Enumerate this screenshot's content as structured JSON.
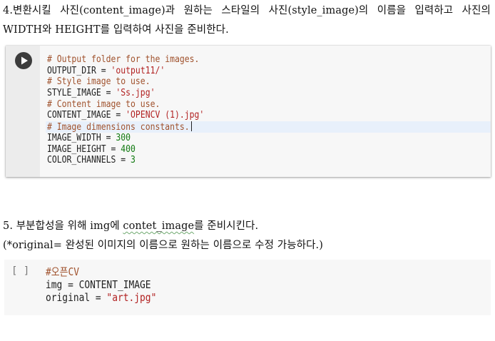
{
  "section4": {
    "text": "4.변환시킬 사진(content_image)과 원하는 스타일의 사진(style_image)의 이름을 입력하고 사진의 WIDTH와 HEIGHT를 입력하여 사진을 준비한다."
  },
  "cell1": {
    "run_button": "run",
    "lines": [
      {
        "parts": [
          {
            "t": "# Output folder for the images.",
            "c": "cm"
          }
        ]
      },
      {
        "parts": [
          {
            "t": "OUTPUT_DIR = ",
            "c": "tx"
          },
          {
            "t": "'output11/'",
            "c": "st"
          }
        ]
      },
      {
        "parts": [
          {
            "t": "# Style image to use.",
            "c": "cm"
          }
        ]
      },
      {
        "parts": [
          {
            "t": "STYLE_IMAGE = ",
            "c": "tx"
          },
          {
            "t": "'Ss.jpg'",
            "c": "st"
          }
        ]
      },
      {
        "parts": [
          {
            "t": "# Content image to use.",
            "c": "cm"
          }
        ]
      },
      {
        "parts": [
          {
            "t": "CONTENT_IMAGE = ",
            "c": "tx"
          },
          {
            "t": "'OPENCV (1).jpg'",
            "c": "st"
          }
        ]
      },
      {
        "parts": [
          {
            "t": "# Image dimensions constants.",
            "c": "cm"
          }
        ],
        "active": true
      },
      {
        "parts": [
          {
            "t": "IMAGE_WIDTH = ",
            "c": "tx"
          },
          {
            "t": "300",
            "c": "nm"
          }
        ]
      },
      {
        "parts": [
          {
            "t": "IMAGE_HEIGHT = ",
            "c": "tx"
          },
          {
            "t": "400",
            "c": "nm"
          }
        ]
      },
      {
        "parts": [
          {
            "t": "COLOR_CHANNELS = ",
            "c": "tx"
          },
          {
            "t": "3",
            "c": "nm"
          }
        ]
      }
    ]
  },
  "section5": {
    "title_pre": "5. 부분합성을 위해 img에 ",
    "title_underlined": "contet_image",
    "title_post": "를 준비시킨다.",
    "note": "(*original= 완성된 이미지의 이름으로 원하는 이름으로 수정 가능하다.)"
  },
  "cell2": {
    "bracket": "[ ]",
    "lines": [
      {
        "parts": [
          {
            "t": "#오픈CV",
            "c": "cm"
          }
        ]
      },
      {
        "parts": [
          {
            "t": "img = CONTENT_IMAGE",
            "c": "tx"
          }
        ]
      },
      {
        "parts": [
          {
            "t": "original = ",
            "c": "tx"
          },
          {
            "t": "\"art.jpg\"",
            "c": "st"
          }
        ]
      }
    ]
  },
  "colors": {
    "comment": "#a0522d",
    "string": "#b22222",
    "number": "#127a12",
    "active_line": "#e8f0fb"
  }
}
